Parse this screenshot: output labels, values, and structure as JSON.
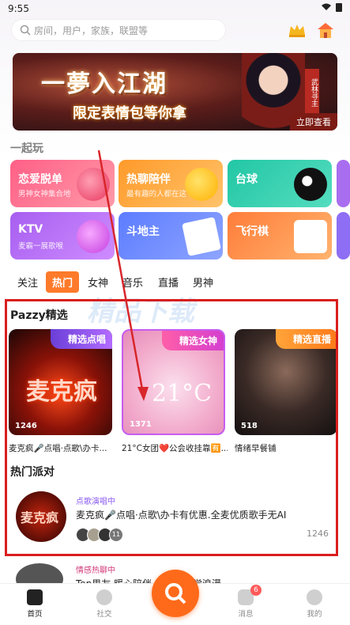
{
  "status_bar": {
    "time": "9:55"
  },
  "search": {
    "placeholder": "房间，用户，家族，联盟等"
  },
  "banner": {
    "title": "一夢入江湖",
    "subtitle": "限定表情包等你拿",
    "seal_text": "武林寻主",
    "cta": "立即查看"
  },
  "section_play": {
    "title": "一起玩"
  },
  "game_cards": [
    {
      "name": "恋爱脱单",
      "sub": "男神女神集合地",
      "color": "#ff6f8f"
    },
    {
      "name": "热聊陪伴",
      "sub": "最有趣的人都在这",
      "color": "#ffa23a"
    },
    {
      "name": "台球",
      "sub": "",
      "color": "#33c9a8"
    },
    {
      "name": "KTV",
      "sub": "麦霸一展歌喉",
      "color": "#b760f0"
    },
    {
      "name": "斗地主",
      "sub": "",
      "color": "#6d8cff"
    },
    {
      "name": "飞行棋",
      "sub": "",
      "color": "#ff8a4c"
    }
  ],
  "tabs": [
    "关注",
    "热门",
    "女神",
    "音乐",
    "直播",
    "男神"
  ],
  "active_tab": "热门",
  "pazzy": {
    "title": "Pazzy精选",
    "items": [
      {
        "badge": "精选点唱",
        "art_text": "麦克疯",
        "count": "1246",
        "caption": "麦克疯🎤点唱·点歌\\办卡..."
      },
      {
        "badge": "精选女神",
        "art_text": "21°C",
        "count": "1371",
        "caption": "21°C女团❤️公会收挂靠🈶..."
      },
      {
        "badge": "精选直播",
        "art_text": "",
        "count": "518",
        "caption": "情绪早餐铺"
      }
    ]
  },
  "hot_party": {
    "title": "热门派对",
    "item": {
      "tag": "点歌演唱中",
      "avatar_text": "麦克疯",
      "title": "麦克疯🎤点唱·点歌\\办卡有优惠.全麦优质歌手无AI",
      "count": "1246",
      "extra_members": "11"
    }
  },
  "next_item": {
    "tag": "情感热聊中",
    "title_partial": "Top男友 暖心陪伴 一起的听觉浪漫"
  },
  "nav": {
    "home": "首页",
    "social": "社交",
    "messages": "消息",
    "messages_badge": "6",
    "me": "我的"
  },
  "watermark": "精品下载"
}
